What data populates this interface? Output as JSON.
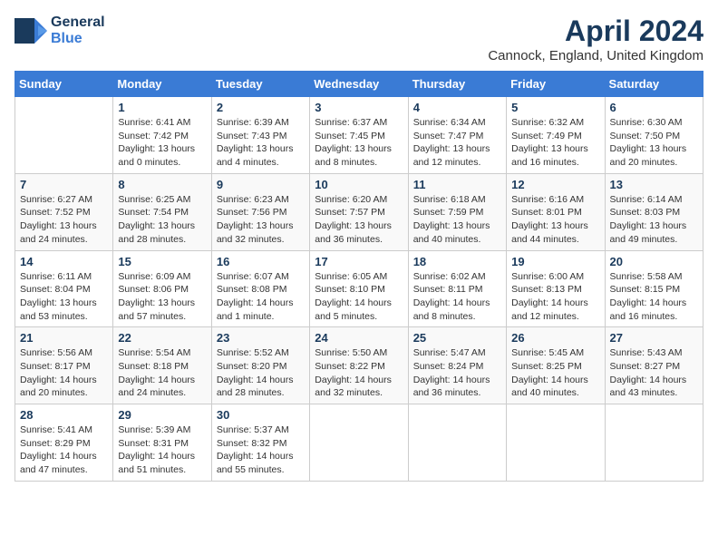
{
  "header": {
    "logo_line1": "General",
    "logo_line2": "Blue",
    "month_title": "April 2024",
    "location": "Cannock, England, United Kingdom"
  },
  "days_of_week": [
    "Sunday",
    "Monday",
    "Tuesday",
    "Wednesday",
    "Thursday",
    "Friday",
    "Saturday"
  ],
  "weeks": [
    [
      {
        "day": "",
        "sunrise": "",
        "sunset": "",
        "daylight": ""
      },
      {
        "day": "1",
        "sunrise": "Sunrise: 6:41 AM",
        "sunset": "Sunset: 7:42 PM",
        "daylight": "Daylight: 13 hours and 0 minutes."
      },
      {
        "day": "2",
        "sunrise": "Sunrise: 6:39 AM",
        "sunset": "Sunset: 7:43 PM",
        "daylight": "Daylight: 13 hours and 4 minutes."
      },
      {
        "day": "3",
        "sunrise": "Sunrise: 6:37 AM",
        "sunset": "Sunset: 7:45 PM",
        "daylight": "Daylight: 13 hours and 8 minutes."
      },
      {
        "day": "4",
        "sunrise": "Sunrise: 6:34 AM",
        "sunset": "Sunset: 7:47 PM",
        "daylight": "Daylight: 13 hours and 12 minutes."
      },
      {
        "day": "5",
        "sunrise": "Sunrise: 6:32 AM",
        "sunset": "Sunset: 7:49 PM",
        "daylight": "Daylight: 13 hours and 16 minutes."
      },
      {
        "day": "6",
        "sunrise": "Sunrise: 6:30 AM",
        "sunset": "Sunset: 7:50 PM",
        "daylight": "Daylight: 13 hours and 20 minutes."
      }
    ],
    [
      {
        "day": "7",
        "sunrise": "Sunrise: 6:27 AM",
        "sunset": "Sunset: 7:52 PM",
        "daylight": "Daylight: 13 hours and 24 minutes."
      },
      {
        "day": "8",
        "sunrise": "Sunrise: 6:25 AM",
        "sunset": "Sunset: 7:54 PM",
        "daylight": "Daylight: 13 hours and 28 minutes."
      },
      {
        "day": "9",
        "sunrise": "Sunrise: 6:23 AM",
        "sunset": "Sunset: 7:56 PM",
        "daylight": "Daylight: 13 hours and 32 minutes."
      },
      {
        "day": "10",
        "sunrise": "Sunrise: 6:20 AM",
        "sunset": "Sunset: 7:57 PM",
        "daylight": "Daylight: 13 hours and 36 minutes."
      },
      {
        "day": "11",
        "sunrise": "Sunrise: 6:18 AM",
        "sunset": "Sunset: 7:59 PM",
        "daylight": "Daylight: 13 hours and 40 minutes."
      },
      {
        "day": "12",
        "sunrise": "Sunrise: 6:16 AM",
        "sunset": "Sunset: 8:01 PM",
        "daylight": "Daylight: 13 hours and 44 minutes."
      },
      {
        "day": "13",
        "sunrise": "Sunrise: 6:14 AM",
        "sunset": "Sunset: 8:03 PM",
        "daylight": "Daylight: 13 hours and 49 minutes."
      }
    ],
    [
      {
        "day": "14",
        "sunrise": "Sunrise: 6:11 AM",
        "sunset": "Sunset: 8:04 PM",
        "daylight": "Daylight: 13 hours and 53 minutes."
      },
      {
        "day": "15",
        "sunrise": "Sunrise: 6:09 AM",
        "sunset": "Sunset: 8:06 PM",
        "daylight": "Daylight: 13 hours and 57 minutes."
      },
      {
        "day": "16",
        "sunrise": "Sunrise: 6:07 AM",
        "sunset": "Sunset: 8:08 PM",
        "daylight": "Daylight: 14 hours and 1 minute."
      },
      {
        "day": "17",
        "sunrise": "Sunrise: 6:05 AM",
        "sunset": "Sunset: 8:10 PM",
        "daylight": "Daylight: 14 hours and 5 minutes."
      },
      {
        "day": "18",
        "sunrise": "Sunrise: 6:02 AM",
        "sunset": "Sunset: 8:11 PM",
        "daylight": "Daylight: 14 hours and 8 minutes."
      },
      {
        "day": "19",
        "sunrise": "Sunrise: 6:00 AM",
        "sunset": "Sunset: 8:13 PM",
        "daylight": "Daylight: 14 hours and 12 minutes."
      },
      {
        "day": "20",
        "sunrise": "Sunrise: 5:58 AM",
        "sunset": "Sunset: 8:15 PM",
        "daylight": "Daylight: 14 hours and 16 minutes."
      }
    ],
    [
      {
        "day": "21",
        "sunrise": "Sunrise: 5:56 AM",
        "sunset": "Sunset: 8:17 PM",
        "daylight": "Daylight: 14 hours and 20 minutes."
      },
      {
        "day": "22",
        "sunrise": "Sunrise: 5:54 AM",
        "sunset": "Sunset: 8:18 PM",
        "daylight": "Daylight: 14 hours and 24 minutes."
      },
      {
        "day": "23",
        "sunrise": "Sunrise: 5:52 AM",
        "sunset": "Sunset: 8:20 PM",
        "daylight": "Daylight: 14 hours and 28 minutes."
      },
      {
        "day": "24",
        "sunrise": "Sunrise: 5:50 AM",
        "sunset": "Sunset: 8:22 PM",
        "daylight": "Daylight: 14 hours and 32 minutes."
      },
      {
        "day": "25",
        "sunrise": "Sunrise: 5:47 AM",
        "sunset": "Sunset: 8:24 PM",
        "daylight": "Daylight: 14 hours and 36 minutes."
      },
      {
        "day": "26",
        "sunrise": "Sunrise: 5:45 AM",
        "sunset": "Sunset: 8:25 PM",
        "daylight": "Daylight: 14 hours and 40 minutes."
      },
      {
        "day": "27",
        "sunrise": "Sunrise: 5:43 AM",
        "sunset": "Sunset: 8:27 PM",
        "daylight": "Daylight: 14 hours and 43 minutes."
      }
    ],
    [
      {
        "day": "28",
        "sunrise": "Sunrise: 5:41 AM",
        "sunset": "Sunset: 8:29 PM",
        "daylight": "Daylight: 14 hours and 47 minutes."
      },
      {
        "day": "29",
        "sunrise": "Sunrise: 5:39 AM",
        "sunset": "Sunset: 8:31 PM",
        "daylight": "Daylight: 14 hours and 51 minutes."
      },
      {
        "day": "30",
        "sunrise": "Sunrise: 5:37 AM",
        "sunset": "Sunset: 8:32 PM",
        "daylight": "Daylight: 14 hours and 55 minutes."
      },
      {
        "day": "",
        "sunrise": "",
        "sunset": "",
        "daylight": ""
      },
      {
        "day": "",
        "sunrise": "",
        "sunset": "",
        "daylight": ""
      },
      {
        "day": "",
        "sunrise": "",
        "sunset": "",
        "daylight": ""
      },
      {
        "day": "",
        "sunrise": "",
        "sunset": "",
        "daylight": ""
      }
    ]
  ]
}
